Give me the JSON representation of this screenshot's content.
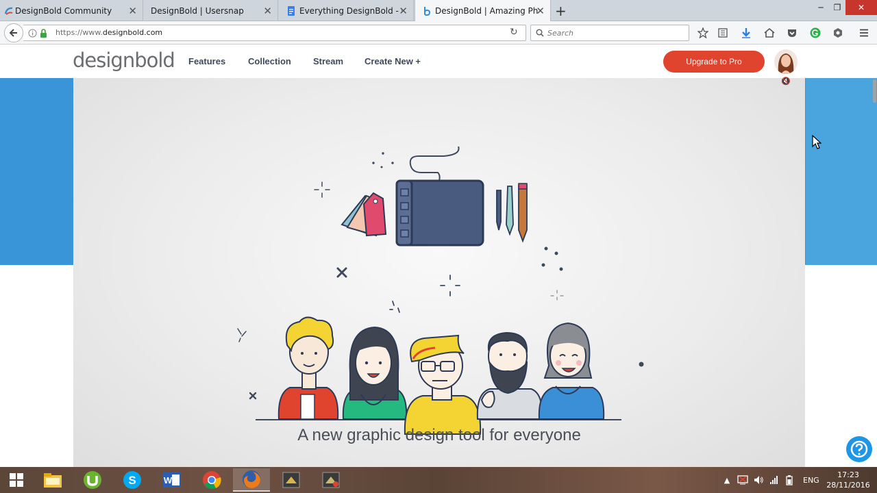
{
  "browser": {
    "tabs": [
      {
        "label": "DesignBold Community",
        "icon": "designbold-community-icon"
      },
      {
        "label": "DesignBold | Usersnap",
        "icon": "usersnap-icon"
      },
      {
        "label": "Everything DesignBold - G...",
        "icon": "google-docs-icon"
      },
      {
        "label": "DesignBold | Amazing Ph...",
        "icon": "designbold-icon"
      }
    ],
    "active_tab": 3,
    "url_prefix": "https://www.",
    "url_domain": "designbold.com",
    "search_placeholder": "Search"
  },
  "site": {
    "logo": "designbold",
    "nav": [
      "Features",
      "Collection",
      "Stream",
      "Create New +"
    ],
    "upgrade_label": "Upgrade to Pro",
    "hero_tagline": "A new graphic design tool for everyone"
  },
  "taskbar": {
    "language": "ENG",
    "time": "17:23",
    "date": "28/11/2016",
    "apps": [
      "file-explorer-icon",
      "utorrent-icon",
      "skype-icon",
      "word-icon",
      "chrome-icon",
      "firefox-icon",
      "app-icon",
      "app-icon-2"
    ]
  },
  "colors": {
    "accent_red": "#e0442f",
    "hero_blue": "#3a95d8",
    "help_blue": "#1e96e8"
  }
}
